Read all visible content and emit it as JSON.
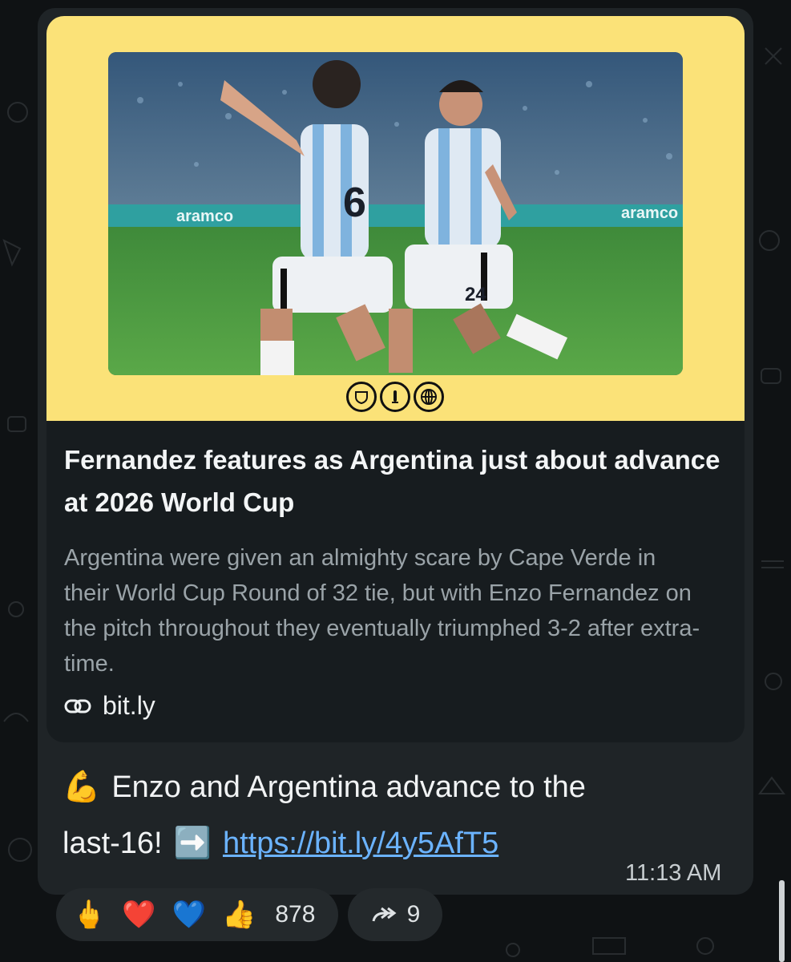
{
  "link_preview": {
    "title": "Fernandez features as Argentina just about advance at 2026 World Cup",
    "description": "Argentina were given an almighty scare by Cape Verde in their World Cup Round of 32 tie, but with Enzo Fernandez on the pitch throughout they eventually triumphed 3-2 after extra-time.",
    "domain": "bit.ly",
    "hero_background": "#fbe278",
    "photo_ad_board_text": "aramco",
    "jersey_numbers": [
      "6",
      "24"
    ],
    "badge_icons": [
      "chelsea-crest-icon",
      "trophy-icon",
      "globe-icon"
    ]
  },
  "message": {
    "emoji_start": "💪",
    "text_line1": "Enzo and Argentina advance to the",
    "text_line2_prefix": "last-16!",
    "arrow_emoji": "➡️",
    "link": "https://bit.ly/4y5AfT5",
    "time": "11:13 AM"
  },
  "reactions": {
    "emojis": [
      "🖕",
      "❤️",
      "💙",
      "👍"
    ],
    "count": "878"
  },
  "forwards": {
    "icon": "share-forward-icon",
    "count": "9"
  },
  "colors": {
    "bubble": "#1f2427",
    "card": "#171c1f",
    "link": "#6bb3ff"
  }
}
